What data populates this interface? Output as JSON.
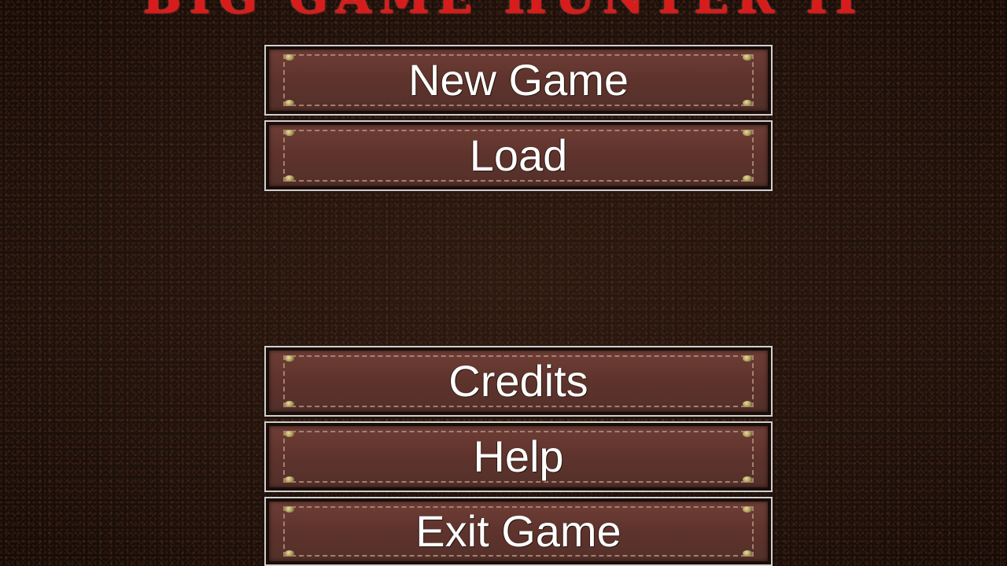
{
  "game": {
    "title": "BIG GAME HUNTER II"
  },
  "menu": {
    "items": [
      {
        "id": "new_game",
        "label": "New Game"
      },
      {
        "id": "load",
        "label": "Load"
      },
      {
        "id": "credits",
        "label": "Credits"
      },
      {
        "id": "help",
        "label": "Help"
      },
      {
        "id": "exit_game",
        "label": "Exit Game"
      }
    ]
  },
  "colors": {
    "title": "#d81c1c",
    "background": "#1f130d",
    "button_leather": "#5e332c",
    "button_border": "#cfcfcf",
    "label_text": "#ffffff"
  }
}
